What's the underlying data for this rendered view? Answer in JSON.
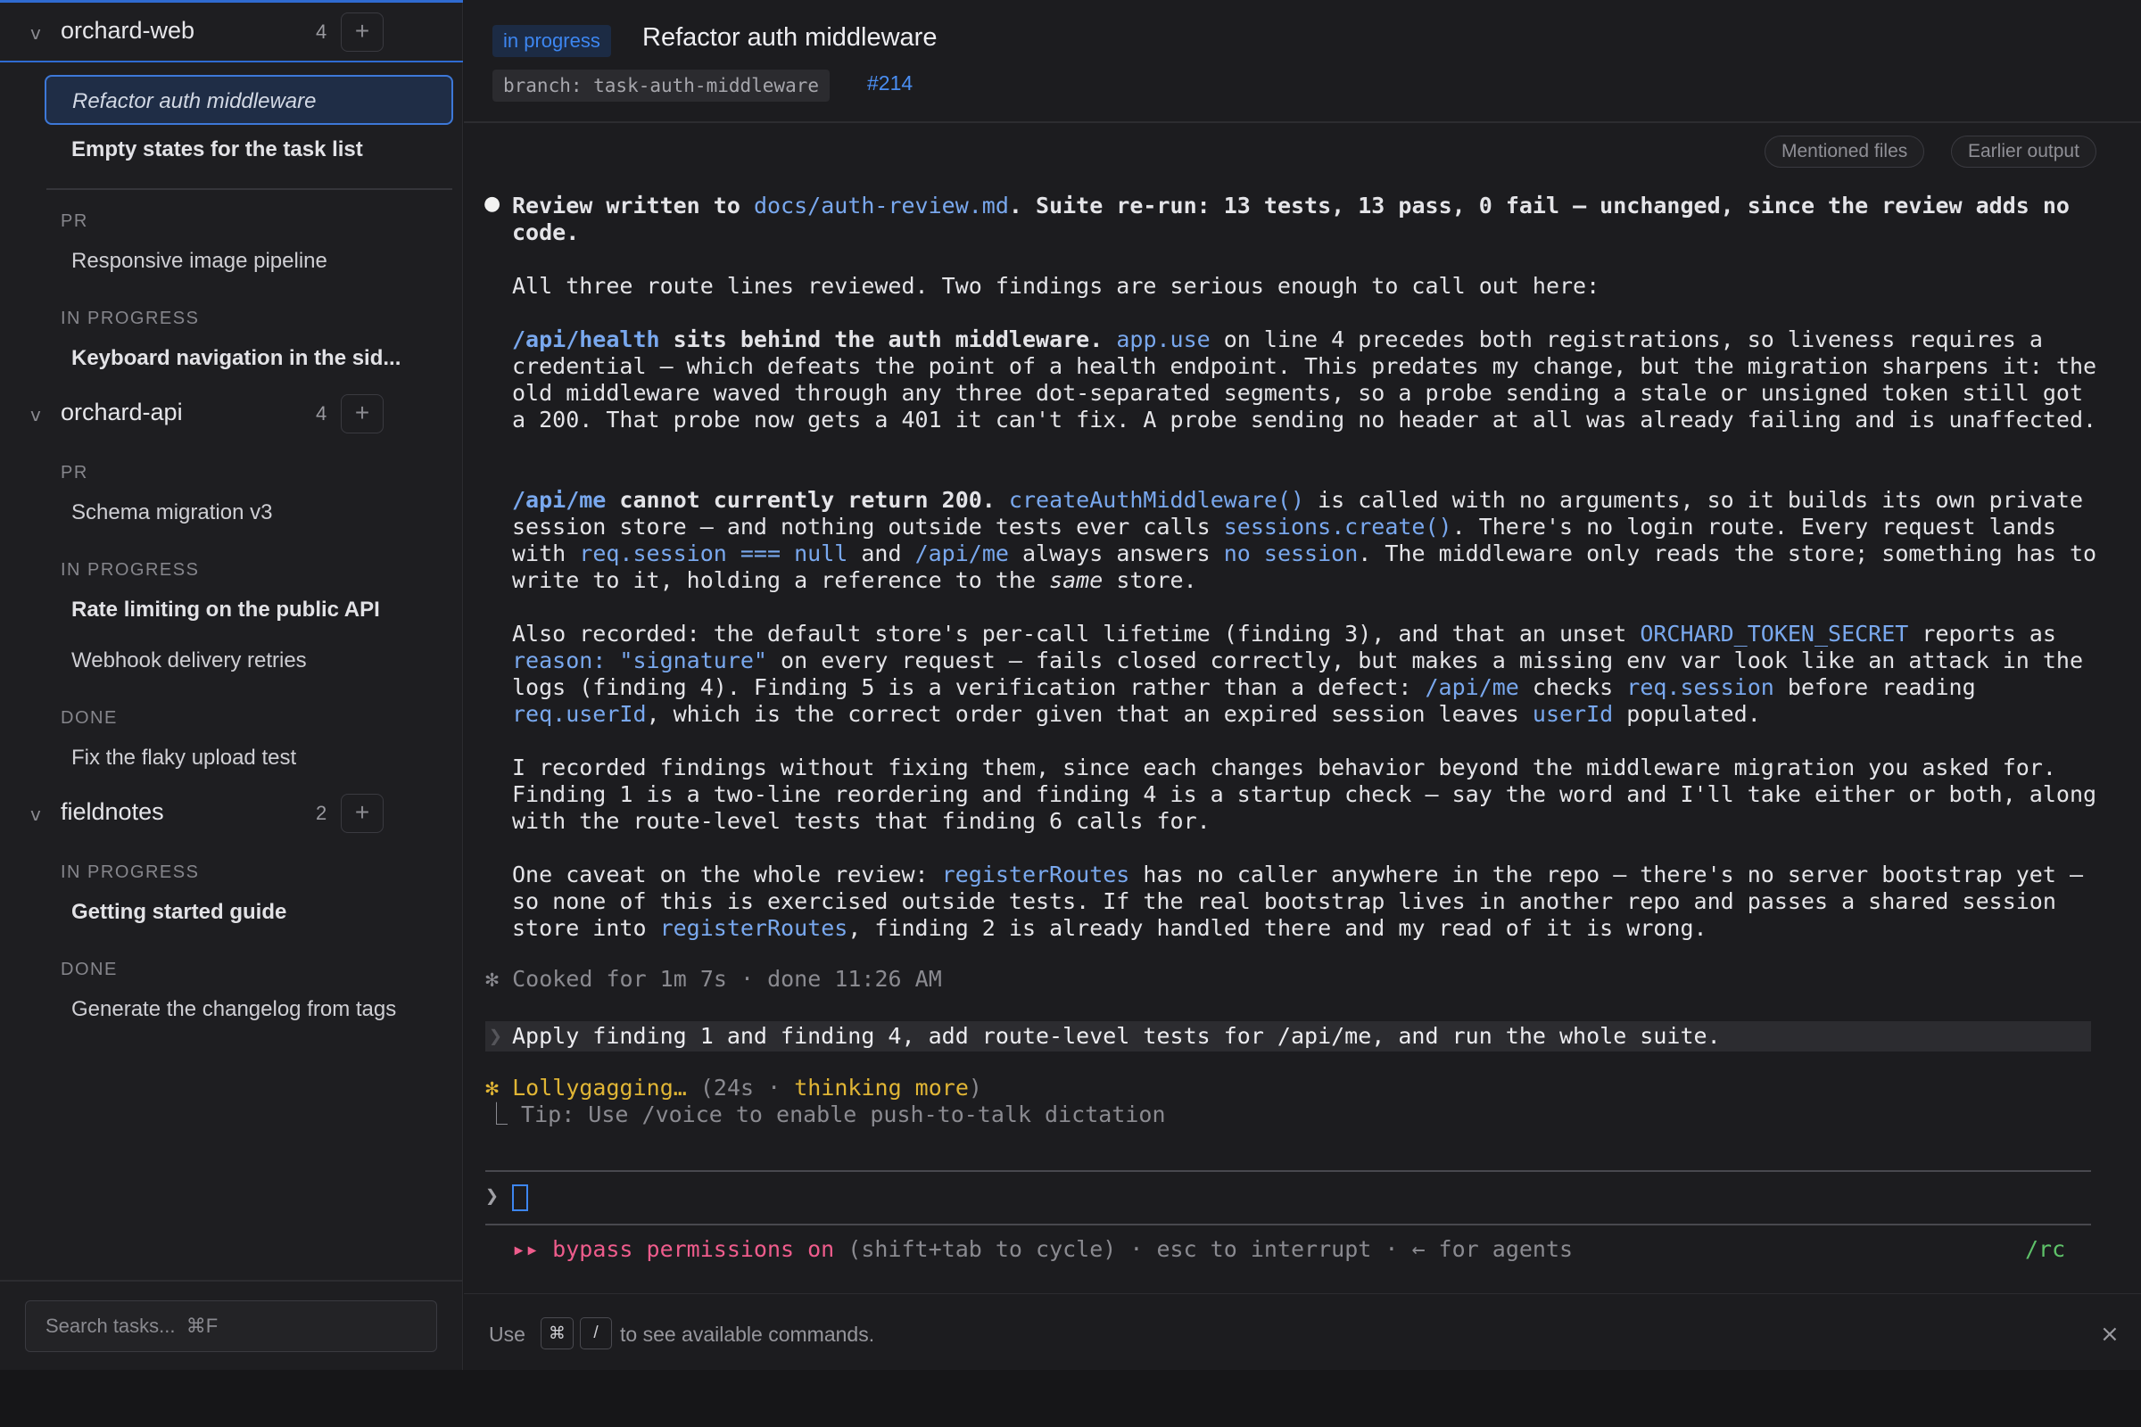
{
  "sidebar": {
    "projects": [
      {
        "name": "orchard-web",
        "count": "4",
        "add": "+",
        "chevron": "v",
        "selected": "Refactor auth middleware",
        "pinned": [
          "Empty states for the task list"
        ],
        "groups": [
          {
            "label": "PR",
            "tasks": [
              "Responsive image pipeline"
            ]
          },
          {
            "label": "IN PROGRESS",
            "tasks": [
              "Keyboard navigation in the sid..."
            ]
          }
        ]
      },
      {
        "name": "orchard-api",
        "count": "4",
        "add": "+",
        "chevron": "v",
        "groups": [
          {
            "label": "PR",
            "tasks": [
              "Schema migration v3"
            ]
          },
          {
            "label": "IN PROGRESS",
            "tasks": [
              "Rate limiting on the public API",
              "Webhook delivery retries"
            ]
          },
          {
            "label": "DONE",
            "tasks": [
              "Fix the flaky upload test"
            ]
          }
        ]
      },
      {
        "name": "fieldnotes",
        "count": "2",
        "add": "+",
        "chevron": "v",
        "groups": [
          {
            "label": "IN PROGRESS",
            "tasks": [
              "Getting started guide"
            ]
          },
          {
            "label": "DONE",
            "tasks": [
              "Generate the changelog from tags"
            ]
          }
        ]
      }
    ],
    "search_placeholder": "Search tasks...  ⌘F"
  },
  "header": {
    "status": "in progress",
    "title": "Refactor auth middleware",
    "branch": "branch: task-auth-middleware",
    "pr": "#214"
  },
  "transcript": {
    "buttons": {
      "mentioned_files": "Mentioned files",
      "earlier_output": "Earlier output"
    },
    "bullet": "●",
    "p1": {
      "a": "Review written to ",
      "file": "docs/auth-review.md",
      "b": ". Suite re-run: 13 tests, 13 pass, 0 fail — unchanged, since the review adds no code."
    },
    "p2": "All three route lines reviewed. Two findings are serious enough to call out here:",
    "p3": {
      "route": "/api/health",
      "lead": " sits behind the auth middleware.",
      "s1": " ",
      "code1": "app.use",
      "rest": " on line 4 precedes both registrations, so liveness requires a credential — which defeats the point of a health endpoint. This predates my change, but the migration sharpens it: the old middleware waved through any three dot-separated segments, so a probe sending a stale or unsigned token still got a 200. That probe now gets a 401 it can't fix. A probe sending no header at all was already failing and is unaffected."
    },
    "p4": {
      "route": "/api/me",
      "lead": " cannot currently return 200.",
      "s1": " ",
      "code1": "createAuthMiddleware()",
      "t1": " is called with no arguments, so it builds its own private session store — and nothing outside tests ever calls ",
      "code2": "sessions.create()",
      "t2": ". There's no login route. Every request lands with ",
      "code3": "req.session === null",
      "t3": " and ",
      "code4": "/api/me",
      "t4": " always answers ",
      "code5": "no session",
      "t5": ". The middleware only reads the store; something has to write to it, holding a reference to the ",
      "em": "same",
      "t6": " store."
    },
    "p5": {
      "t1": "Also recorded: the default store's per-call lifetime (finding 3), and that an unset ",
      "code1": "ORCHARD_TOKEN_SECRET",
      "t2": " reports as ",
      "code2": "reason: \"signature\"",
      "t3": " on every request — fails closed correctly, but makes a missing env var look like an attack in the logs (finding 4). Finding 5 is a verification rather than a defect: ",
      "code3": "/api/me",
      "t4": " checks ",
      "code4": "req.session",
      "t5": " before reading ",
      "code5": "req.userId",
      "t6": ", which is the correct order given that an expired session leaves ",
      "code6": "userId",
      "t7": " populated."
    },
    "p6": "I recorded findings without fixing them, since each changes behavior beyond the middleware migration you asked for. Finding 1 is a two-line reordering and finding 4 is a startup check — say the word and I'll take either or both, along with the route-level tests that finding 6 calls for.",
    "p7": {
      "t1": "One caveat on the whole review: ",
      "code1": "registerRoutes",
      "t2": " has no caller anywhere in the repo — there's no server bootstrap yet — so none of this is exercised outside tests. If the real bootstrap lives in another repo and passes a shared session store into ",
      "code2": "registerRoutes",
      "t3": ", finding 2 is already handled there and my read of it is wrong."
    },
    "cooked": "✻ Cooked for 1m 7s · done 11:26 AM",
    "history_arrow": "❯",
    "history_prompt": "Apply finding 1 and finding 4, add route-level tests for /api/me, and run the whole suite.",
    "thinking": {
      "star": "✻",
      "word": "Lollygagging…",
      "open": " (24s · ",
      "more": "thinking more",
      "close": ")"
    },
    "tip": "  ⎿ Tip: Use /voice to enable push-to-talk dictation"
  },
  "input": {
    "prompt": "❯"
  },
  "mode": {
    "arrows": "▸▸",
    "label": " bypass permissions on",
    "hint": " (shift+tab to cycle) · esc to interrupt · ← for agents",
    "rc": "/rc"
  },
  "footer": {
    "use": "Use",
    "key1": "⌘",
    "key2": "/",
    "rest": "to see available commands.",
    "close": "×"
  },
  "colors": {
    "accent": "#3d86f0",
    "code": "#79a8ee",
    "warning": "#e0b535",
    "danger": "#ef5c8c",
    "ok": "#5ec269"
  }
}
